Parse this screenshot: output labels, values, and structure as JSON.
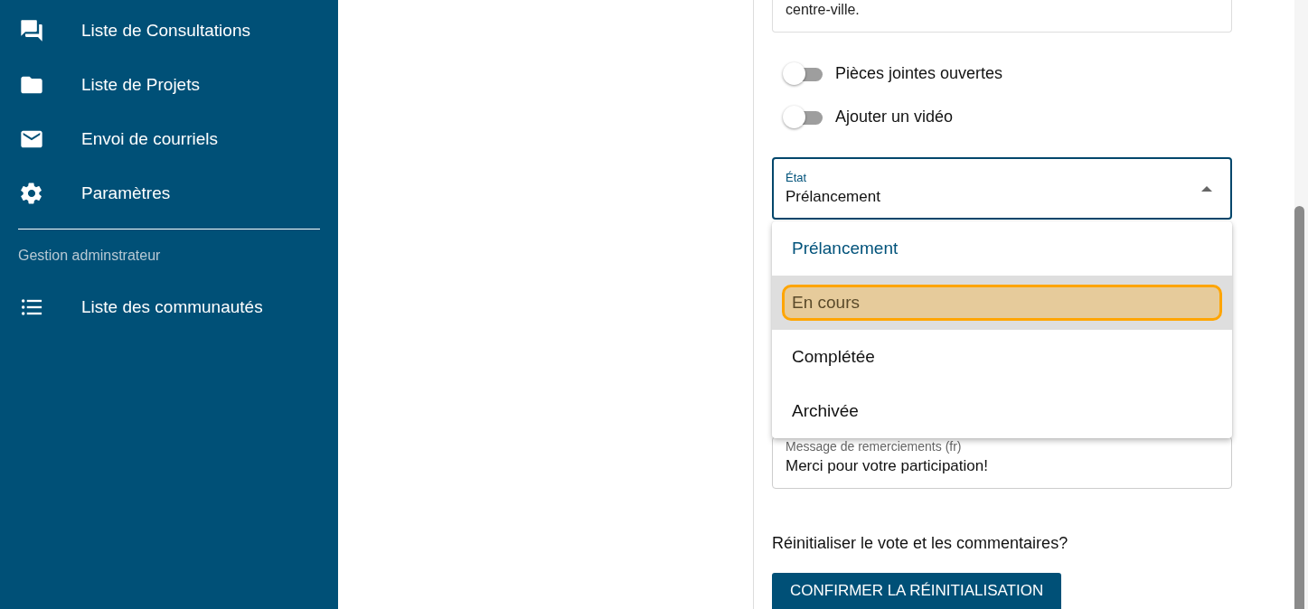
{
  "sidebar": {
    "items": [
      {
        "kind": "chat",
        "label": "Liste de Consultations"
      },
      {
        "kind": "folder",
        "label": "Liste de Projets"
      },
      {
        "kind": "mail",
        "label": "Envoi de courriels"
      },
      {
        "kind": "gear",
        "label": "Paramètres"
      }
    ],
    "section_title": "Gestion adminstrateur",
    "admin_items": [
      {
        "kind": "list",
        "label": "Liste des communautés"
      }
    ]
  },
  "form": {
    "description_tail": "centre-ville.",
    "toggles": [
      {
        "label": "Pièces jointes ouvertes",
        "on": false
      },
      {
        "label": "Ajouter un vidéo",
        "on": false
      }
    ],
    "state_select": {
      "label": "État",
      "value": "Prélancement",
      "expanded": true,
      "options": [
        {
          "label": "Prélancement",
          "selected": true,
          "highlighted": false
        },
        {
          "label": "En cours",
          "selected": false,
          "highlighted": true
        },
        {
          "label": "Complétée",
          "selected": false,
          "highlighted": false
        },
        {
          "label": "Archivée",
          "selected": false,
          "highlighted": false
        }
      ]
    },
    "thanks_field": {
      "label": "Message de remerciements (fr)",
      "value": "Merci pour votre participation!"
    },
    "reset_question": "Réinitialiser le vote et les commentaires?",
    "reset_button": "CONFIRMER LA RÉINITIALISATION"
  }
}
